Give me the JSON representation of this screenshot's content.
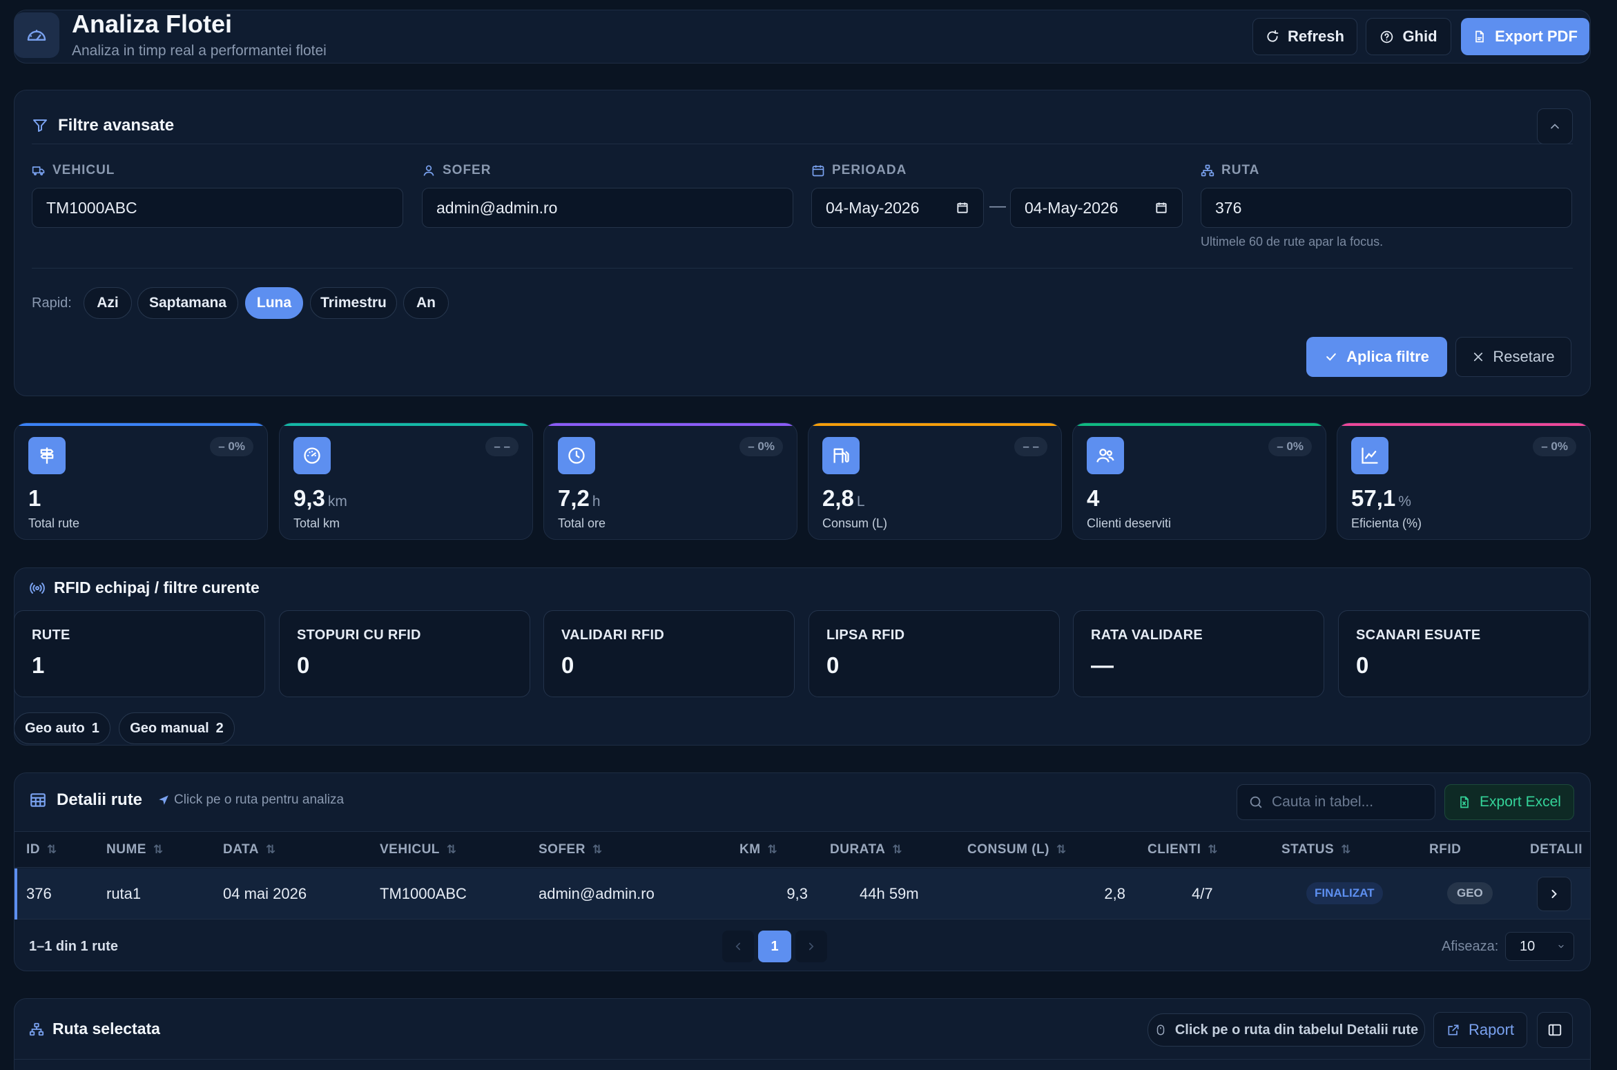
{
  "header": {
    "title": "Analiza Flotei",
    "subtitle": "Analiza in timp real a performantei flotei",
    "refresh_label": "Refresh",
    "guide_label": "Ghid",
    "export_pdf_label": "Export PDF"
  },
  "filters": {
    "title": "Filtre avansate",
    "vehicle_label": "VEHICUL",
    "vehicle_value": "TM1000ABC",
    "driver_label": "SOFER",
    "driver_value": "admin@admin.ro",
    "period_label": "PERIOADA",
    "date_from": "04-May-2026",
    "date_sep": "—",
    "date_to": "04-May-2026",
    "route_label": "RUTA",
    "route_value": "376",
    "route_hint": "Ultimele 60 de rute apar la focus.",
    "quick_label": "Rapid:",
    "quick_options": [
      "Azi",
      "Saptamana",
      "Luna",
      "Trimestru",
      "An"
    ],
    "quick_selected": "Luna",
    "apply_label": "Aplica filtre",
    "reset_label": "Resetare"
  },
  "kpis": [
    {
      "value": "1",
      "unit": "",
      "label": "Total rute",
      "delta": "– 0%",
      "icon": "signpost-icon",
      "accent": "#3b82f6"
    },
    {
      "value": "9,3",
      "unit": "km",
      "label": "Total km",
      "delta": "– –",
      "icon": "gauge-icon",
      "accent": "#14b8a6"
    },
    {
      "value": "7,2",
      "unit": "h",
      "label": "Total ore",
      "delta": "– 0%",
      "icon": "clock-icon",
      "accent": "#8b5cf6"
    },
    {
      "value": "2,8",
      "unit": "L",
      "label": "Consum (L)",
      "delta": "– –",
      "icon": "fuel-icon",
      "accent": "#f59e0b"
    },
    {
      "value": "4",
      "unit": "",
      "label": "Clienti deserviti",
      "delta": "– 0%",
      "icon": "users-icon",
      "accent": "#10b981"
    },
    {
      "value": "57,1",
      "unit": "%",
      "label": "Eficienta (%)",
      "delta": "– 0%",
      "icon": "trend-icon",
      "accent": "#ec4899"
    }
  ],
  "rfid": {
    "title": "RFID echipaj / filtre curente",
    "stats": [
      {
        "label": "RUTE",
        "value": "1"
      },
      {
        "label": "STOPURI CU RFID",
        "value": "0"
      },
      {
        "label": "VALIDARI RFID",
        "value": "0"
      },
      {
        "label": "LIPSA RFID",
        "value": "0"
      },
      {
        "label": "RATA VALIDARE",
        "value": "—"
      },
      {
        "label": "SCANARI ESUATE",
        "value": "0"
      }
    ],
    "geo_auto_label": "Geo auto",
    "geo_auto_value": "1",
    "geo_manual_label": "Geo manual",
    "geo_manual_value": "2"
  },
  "routes_table": {
    "title": "Detalii rute",
    "hint": "Click pe o ruta pentru analiza",
    "search_placeholder": "Cauta in tabel...",
    "export_excel_label": "Export Excel",
    "columns": [
      "ID",
      "NUME",
      "DATA",
      "VEHICUL",
      "SOFER",
      "KM",
      "DURATA",
      "CONSUM (L)",
      "CLIENTI",
      "STATUS",
      "RFID",
      "DETALII"
    ],
    "rows": [
      {
        "id": "376",
        "name": "ruta1",
        "date": "04 mai 2026",
        "vehicle": "TM1000ABC",
        "driver": "admin@admin.ro",
        "km": "9,3",
        "duration": "44h 59m",
        "consumption": "2,8",
        "clients": "4/7",
        "status": "FINALIZAT",
        "rfid": "GEO"
      }
    ],
    "range_text": "1–1 din 1 rute",
    "current_page": "1",
    "per_page_label": "Afiseaza:",
    "per_page_value": "10"
  },
  "selected_route": {
    "title": "Ruta selectata",
    "hint": "Click pe o ruta din tabelul Detalii rute",
    "report_label": "Raport"
  },
  "colors": {
    "background": "#0a1422",
    "card": "#0f1c30",
    "accent": "#5d8ff0",
    "excel_green": "#22c55e"
  }
}
